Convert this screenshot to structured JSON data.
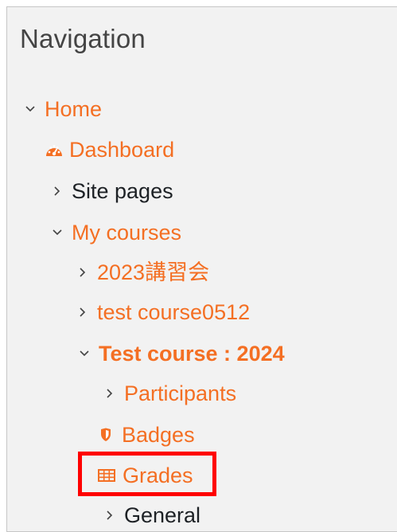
{
  "navigation": {
    "title": "Navigation",
    "items": [
      {
        "label": "Home"
      },
      {
        "label": "Dashboard"
      },
      {
        "label": "Site pages"
      },
      {
        "label": "My courses"
      },
      {
        "label": "2023講習会"
      },
      {
        "label": "test course0512"
      },
      {
        "label": "Test course : 2024"
      },
      {
        "label": "Participants"
      },
      {
        "label": "Badges"
      },
      {
        "label": "Grades"
      },
      {
        "label": "General"
      }
    ]
  },
  "colors": {
    "link": "#f46f23",
    "text": "#1d2125",
    "panel_background": "#f2f2f2",
    "highlight_box": "#ff0000"
  },
  "icons": {
    "expanded": "chevron-down-icon",
    "collapsed": "chevron-right-icon",
    "dashboard": "dashboard-gauge-icon",
    "badges": "shield-icon",
    "grades": "table-icon"
  }
}
